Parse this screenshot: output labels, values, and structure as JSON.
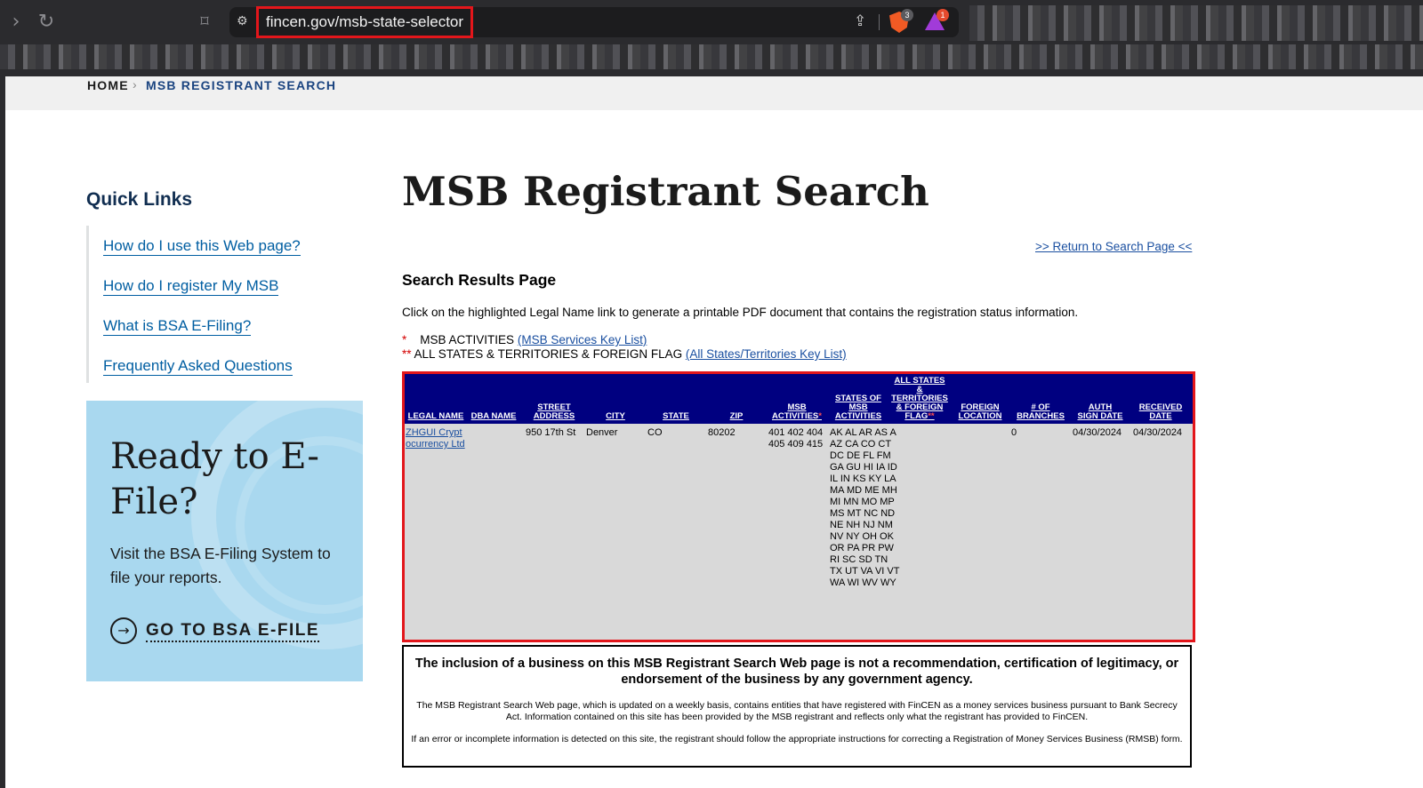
{
  "browser": {
    "url": "fincen.gov/msb-state-selector",
    "shields_badge": "3",
    "rewards_badge": "1"
  },
  "breadcrumb": {
    "home": "HOME",
    "separator": "›",
    "current": "MSB REGISTRANT SEARCH"
  },
  "quick_links": {
    "title": "Quick Links",
    "items": [
      "How do I use this Web page?",
      "How do I register My MSB",
      "What is BSA E-Filing?",
      "Frequently Asked Questions"
    ]
  },
  "efile_promo": {
    "title": "Ready to E-File?",
    "text": "Visit the BSA E-Filing System to file your reports.",
    "cta": "GO TO BSA E-FILE"
  },
  "main": {
    "title": "MSB Registrant Search",
    "return_link": ">> Return to Search Page <<",
    "results_title": "Search Results Page",
    "instruction": "Click on the highlighted Legal Name link to generate a printable PDF document that contains the registration status information.",
    "key1_marker": "*",
    "key1_text": "MSB ACTIVITIES",
    "key1_link": "(MSB Services Key List)",
    "key2_marker": "**",
    "key2_text": "ALL STATES & TERRITORIES & FOREIGN FLAG",
    "key2_link": "(All States/Territories Key List)"
  },
  "table": {
    "headers": {
      "legal_name": "LEGAL NAME",
      "dba_name": "DBA NAME",
      "street_address": "STREET ADDRESS",
      "city": "CITY",
      "state": "STATE",
      "zip": "ZIP",
      "msb_activities": "MSB ACTIVITIES",
      "msb_activities_marker": "*",
      "states_of_msb_activities": "STATES OF MSB ACTIVITIES",
      "all_states": "ALL STATES & TERRITORIES & FOREIGN FLAG",
      "all_states_marker": "**",
      "foreign_location": "FOREIGN LOCATION",
      "num_branches": "# OF BRANCHES",
      "auth_sign_date": "AUTH SIGN DATE",
      "received_date": "RECEIVED DATE"
    },
    "row": {
      "legal_name": "ZHGUI Cryptocurrency Ltd",
      "dba_name": "",
      "street_address": "950 17th St",
      "city": "Denver",
      "state": "CO",
      "zip": "80202",
      "msb_activities": "401 402 404 405 409 415",
      "states_of_msb_activities": "AK AL AR AS A AZ CA CO CT DC DE FL FM GA GU HI IA ID IL IN KS KY LA MA MD ME MH MI MN MO MP MS MT NC ND NE NH NJ NM NV NY OH OK OR PA PR PW RI SC SD TN TX UT VA VI VT WA WI WV WY",
      "foreign_location": "",
      "num_branches": "0",
      "auth_sign_date": "04/30/2024",
      "received_date": "04/30/2024"
    }
  },
  "disclaimer": {
    "bold": "The inclusion of a business on this MSB Registrant Search Web page is not a recommendation, certification of legitimacy, or endorsement of the business by any government agency.",
    "p1": "The MSB Registrant Search Web page, which is updated on a weekly basis, contains entities that have registered with FinCEN as a money services business pursuant to Bank Secrecy Act. Information contained on this site has been provided by the MSB registrant and reflects only what the registrant has provided to FinCEN.",
    "p2": "If an error or incomplete information is detected on this site, the registrant should follow the appropriate instructions for correcting a Registration of Money Services Business (RMSB) form."
  }
}
